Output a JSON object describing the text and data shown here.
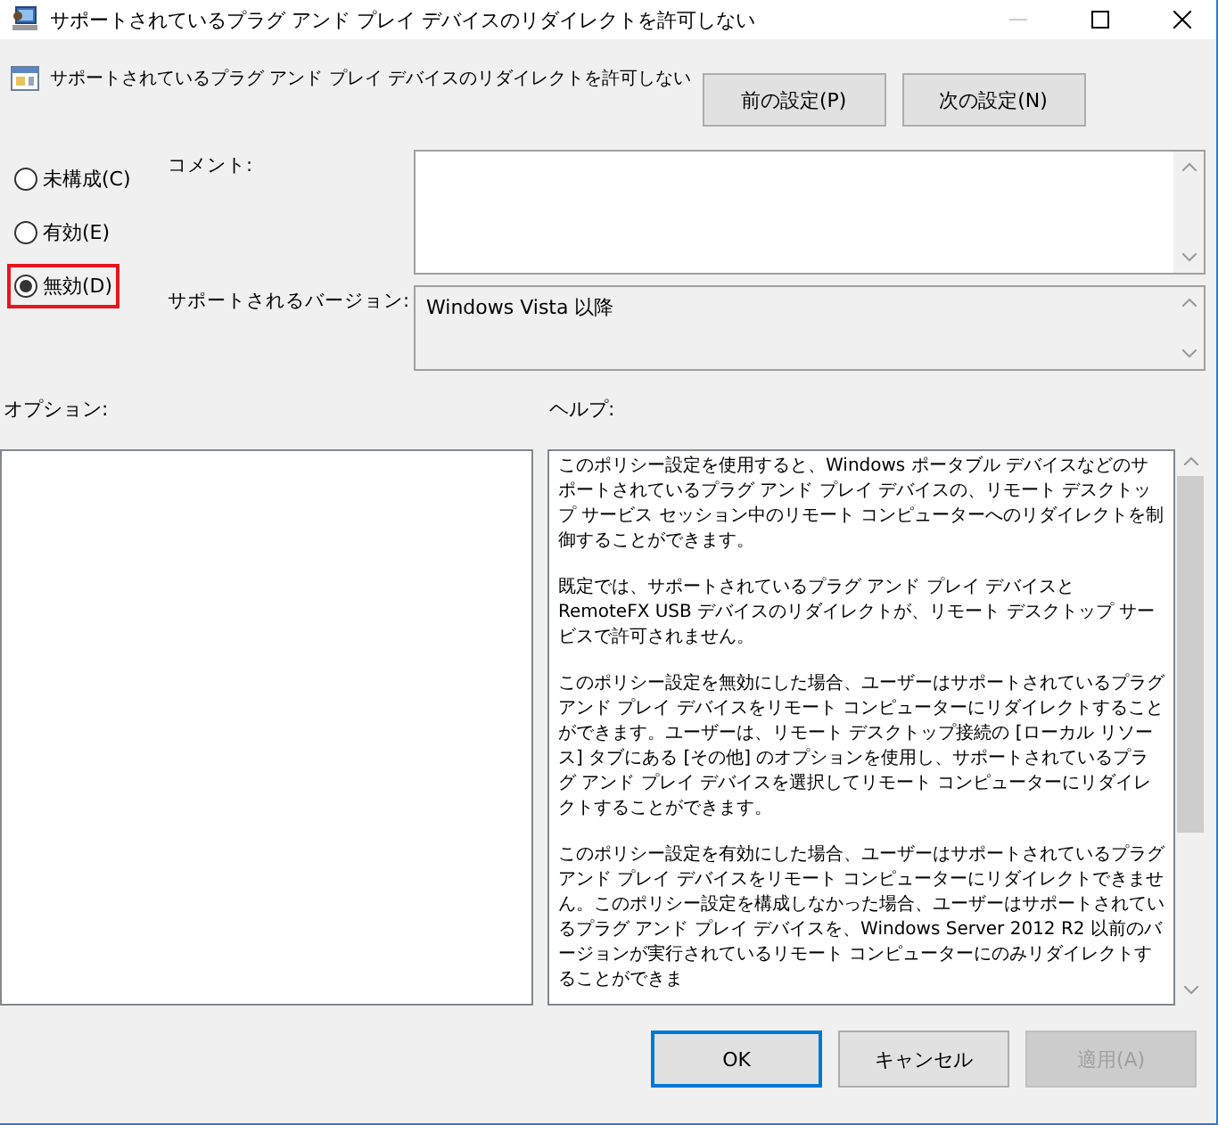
{
  "window": {
    "title": "サポートされているプラグ アンド プレイ デバイスのリダイレクトを許可しない"
  },
  "policy": {
    "title": "サポートされているプラグ アンド プレイ デバイスのリダイレクトを許可しない"
  },
  "nav_buttons": [
    "前の設定(P)",
    "次の設定(N)"
  ],
  "states": [
    {
      "label": "未構成(C)",
      "selected": false,
      "highlighted": false
    },
    {
      "label": "有効(E)",
      "selected": false,
      "highlighted": false
    },
    {
      "label": "無効(D)",
      "selected": true,
      "highlighted": true
    }
  ],
  "comment": {
    "label": "コメント:"
  },
  "supported": {
    "label": "サポートされるバージョン:",
    "value": "Windows Vista 以降"
  },
  "options_label": "オプション:",
  "help_label": "ヘルプ:",
  "help": [
    "このポリシー設定を使用すると、Windows ポータブル デバイスなどのサポートされているプラグ アンド プレイ デバイスの、リモート デスクトップ サービス セッション中のリモート コンピューターへのリダイレクトを制御することができます。",
    "既定では、サポートされているプラグ アンド プレイ デバイスと RemoteFX USB デバイスのリダイレクトが、リモート デスクトップ サービスで許可されません。",
    "このポリシー設定を無効にした場合、ユーザーはサポートされているプラグアンド プレイ デバイスをリモート コンピューターにリダイレクトすることができます。ユーザーは、リモート デスクトップ接続の [ローカル リソース] タブにある [その他] のオプションを使用し、サポートされているプラグ アンド プレイ デバイスを選択してリモート コンピューターにリダイレクトすることができます。",
    "このポリシー設定を有効にした場合、ユーザーはサポートされているプラグアンド プレイ デバイスをリモート コンピューターにリダイレクトできません。このポリシー設定を構成しなかった場合、ユーザーはサポートされているプラグ アンド プレイ デバイスを、Windows Server 2012 R2 以前のバージョンが実行されているリモート コンピューターにのみリダイレクトすることができま"
  ],
  "buttons": [
    {
      "label": "OK",
      "default": true,
      "disabled": false
    },
    {
      "label": "キャンセル",
      "default": false,
      "disabled": false
    },
    {
      "label": "適用(A)",
      "default": false,
      "disabled": true
    }
  ]
}
